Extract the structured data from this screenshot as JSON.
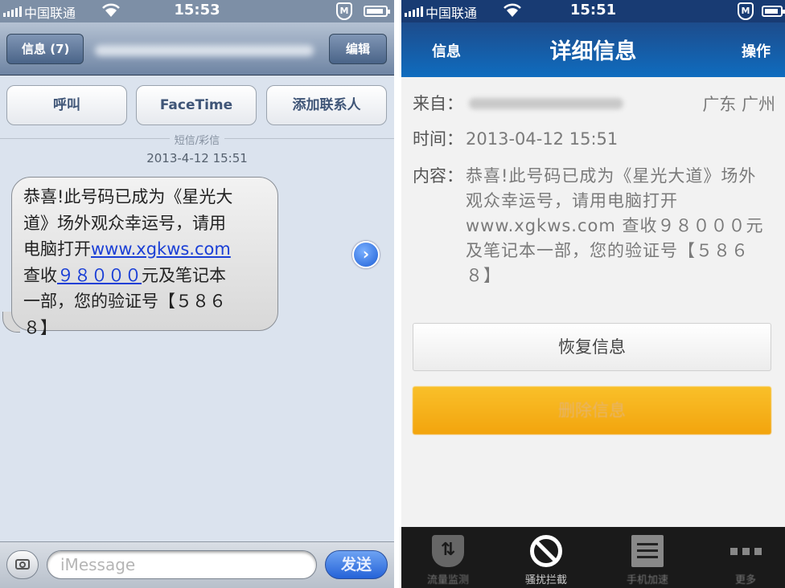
{
  "left_phone": {
    "status": {
      "carrier": "中国联通",
      "time": "15:53",
      "shield": "M"
    },
    "nav": {
      "back_label": "信息 (7)",
      "edit_label": "编辑"
    },
    "actions": [
      "呼叫",
      "FaceTime",
      "添加联系人"
    ],
    "separator_label": "短信/彩信",
    "timestamp": "2013-4-12 15:51",
    "message": {
      "lines": [
        "恭喜!此号码已成为《星光大",
        "道》场外观众幸运号，请用",
        "电脑打开",
        "查收",
        "元及笔记本",
        "一部，您的验证号【５８６",
        "８】"
      ],
      "link_url": "www.xgkws.com",
      "link_amount": "９８０００"
    },
    "input": {
      "placeholder": "iMessage",
      "send_label": "发送"
    }
  },
  "right_phone": {
    "status": {
      "carrier": "中国联通",
      "time": "15:51",
      "shield": "M"
    },
    "nav": {
      "left": "信息",
      "title": "详细信息",
      "right": "操作"
    },
    "from_label": "来自：",
    "from_location": "广东 广州",
    "time_label": "时间：",
    "time_value": "2013-04-12 15:51",
    "content_label": "内容：",
    "content_text": "恭喜!此号码已成为《星光大道》场外观众幸运号，请用电脑打开www.xgkws.com 查收９８０００元及笔记本一部，您的验证号【５８６８】",
    "restore_label": "恢复信息",
    "delete_label": "删除信息",
    "tabs": [
      {
        "label": "流量监测",
        "icon": "shield-arrows-icon"
      },
      {
        "label": "骚扰拦截",
        "icon": "no-entry-icon",
        "active": true
      },
      {
        "label": "手机加速",
        "icon": "document-icon"
      },
      {
        "label": "更多",
        "icon": "more-icon"
      }
    ]
  }
}
